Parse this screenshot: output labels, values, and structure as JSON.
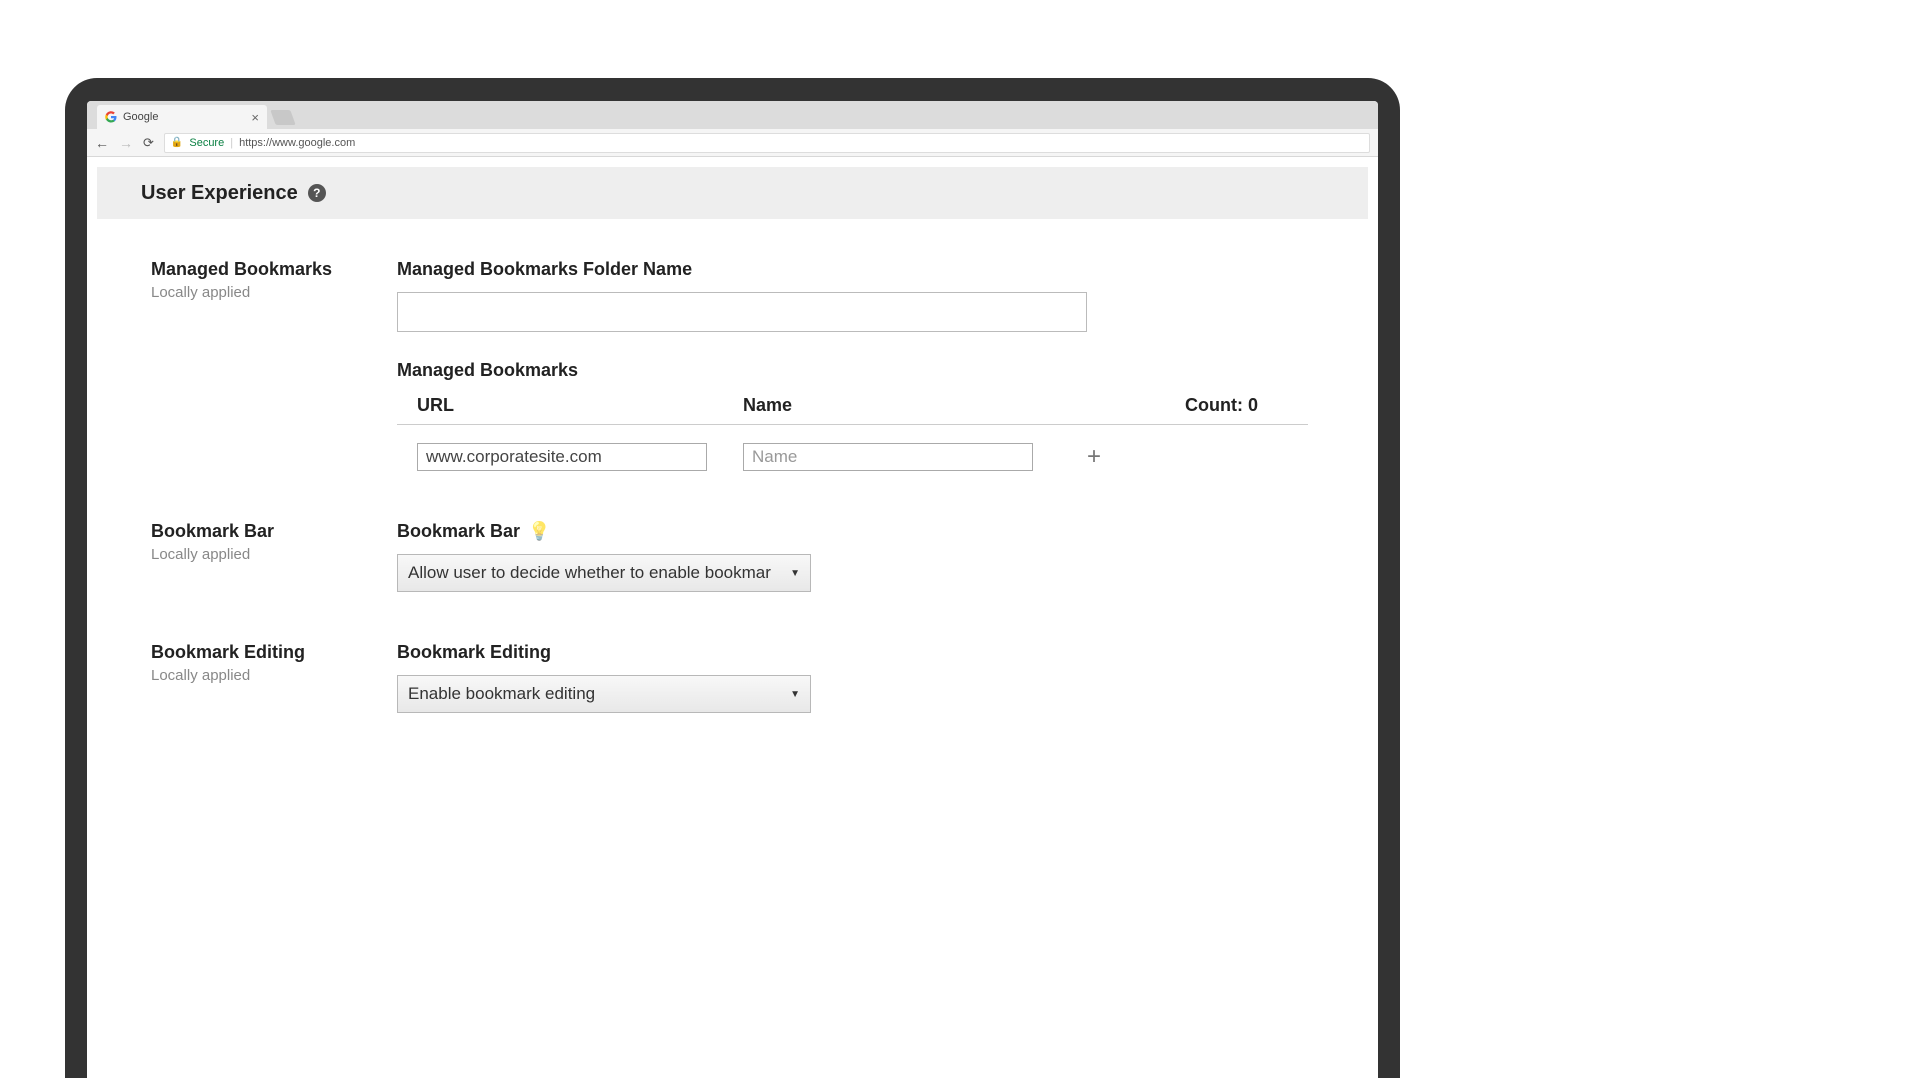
{
  "browser": {
    "tab_title": "Google",
    "secure_label": "Secure",
    "url": "https://www.google.com"
  },
  "header": {
    "title": "User Experience"
  },
  "sections": {
    "managed_bookmarks": {
      "title": "Managed Bookmarks",
      "applied": "Locally applied",
      "folder_label": "Managed Bookmarks Folder Name",
      "folder_value": "",
      "list_label": "Managed Bookmarks",
      "columns": {
        "url": "URL",
        "name": "Name"
      },
      "count_label": "Count: 0",
      "row": {
        "url_value": "www.corporatesite.com",
        "name_placeholder": "Name",
        "name_value": ""
      }
    },
    "bookmark_bar": {
      "title": "Bookmark Bar",
      "applied": "Locally applied",
      "label": "Bookmark Bar",
      "select_value": "Allow user to decide whether to enable bookmar"
    },
    "bookmark_editing": {
      "title": "Bookmark Editing",
      "applied": "Locally applied",
      "label": "Bookmark Editing",
      "select_value": "Enable bookmark editing"
    }
  }
}
